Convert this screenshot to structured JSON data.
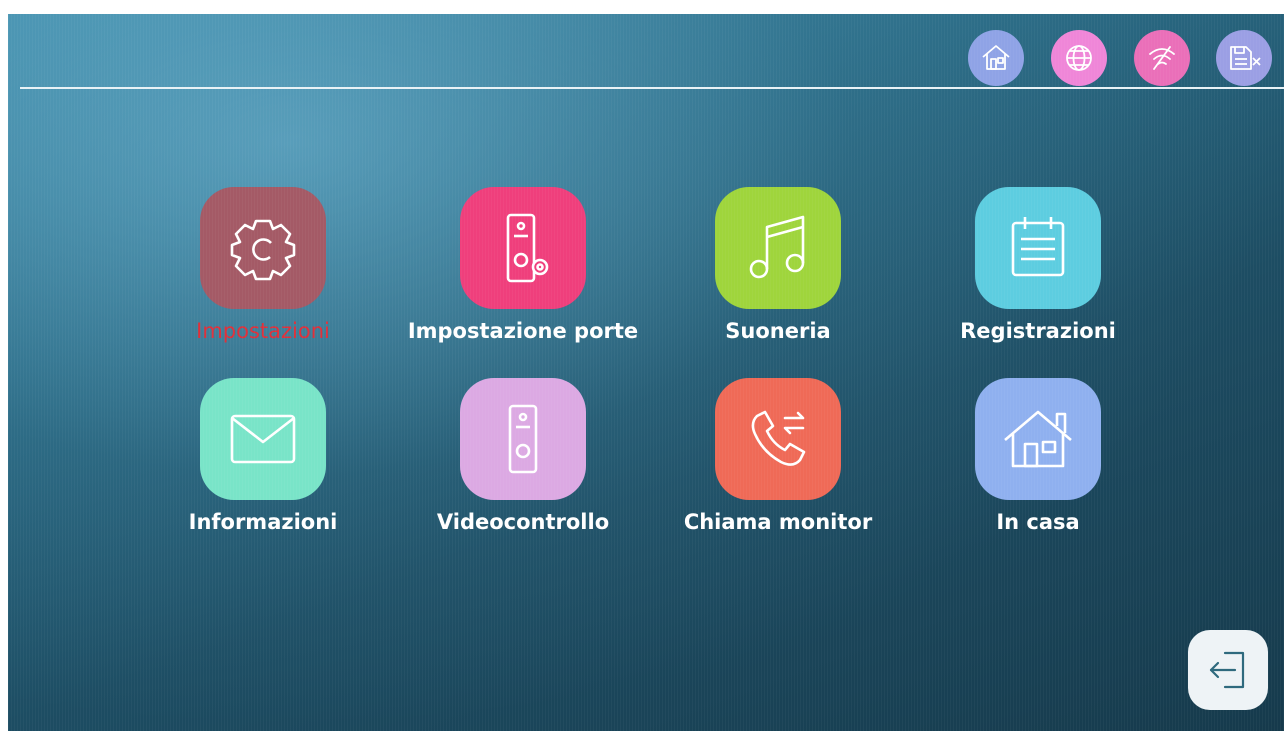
{
  "status_bar": {
    "icons": [
      {
        "name": "home-status-icon",
        "color": "#8fa3e6"
      },
      {
        "name": "globe-icon",
        "color": "#ef86d8"
      },
      {
        "name": "wifi-off-icon",
        "color": "#ea6fb9"
      },
      {
        "name": "sd-card-off-icon",
        "color": "#9b9fe4"
      }
    ]
  },
  "menu": {
    "items": [
      {
        "label": "Impostazioni",
        "icon": "gear-icon",
        "color": "#a45a66",
        "active": true
      },
      {
        "label": "Impostazione porte",
        "icon": "door-station-settings-icon",
        "color": "#ef3f7c"
      },
      {
        "label": "Suoneria",
        "icon": "music-note-icon",
        "color": "#9fd53c"
      },
      {
        "label": "Registrazioni",
        "icon": "calendar-list-icon",
        "color": "#5dcde0"
      },
      {
        "label": "Informazioni",
        "icon": "envelope-icon",
        "color": "#79e4c8"
      },
      {
        "label": "Videocontrollo",
        "icon": "door-station-icon",
        "color": "#dca9e3"
      },
      {
        "label": "Chiama monitor",
        "icon": "phone-transfer-icon",
        "color": "#ef6a57"
      },
      {
        "label": "In casa",
        "icon": "house-icon",
        "color": "#8fb0ef"
      }
    ]
  },
  "back_button": {
    "icon": "exit-arrow-icon"
  }
}
